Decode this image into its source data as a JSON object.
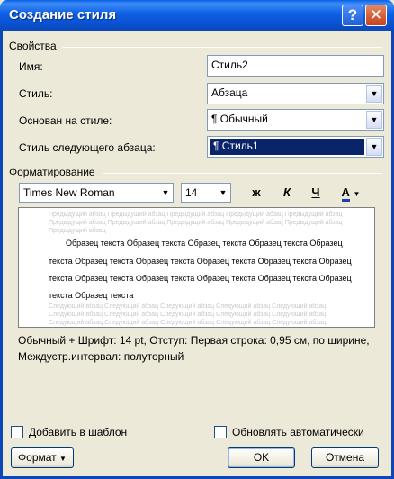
{
  "window": {
    "title": "Создание стиля"
  },
  "properties": {
    "group_label": "Свойства",
    "name_label": "Имя:",
    "name_value": "Стиль2",
    "style_label": "Стиль:",
    "style_value": "Абзаца",
    "based_on_label": "Основан на стиле:",
    "based_on_value": "¶ Обычный",
    "next_label": "Стиль следующего абзаца:",
    "next_value": "¶ Стиль1"
  },
  "formatting": {
    "group_label": "Форматирование",
    "font_name": "Times New Roman",
    "font_size": "14",
    "bold": "ж",
    "italic": "К",
    "underline": "Ч",
    "font_color": "А"
  },
  "preview": {
    "ghost_prev": "Предыдущий абзац Предыдущий абзац Предыдущий абзац Предыдущий абзац Предыдущий абзац",
    "ghost_prev2": "Предыдущий абзац Предыдущий абзац Предыдущий абзац Предыдущий абзац Предыдущий абзац",
    "ghost_prev3": "Предыдущий абзац",
    "line1": "Образец текста Образец текста Образец текста Образец текста Образец",
    "line2": "текста Образец текста Образец текста Образец текста Образец текста Образец",
    "line3": "текста Образец текста Образец текста Образец текста Образец текста Образец",
    "line4": "текста Образец текста",
    "ghost_next": "Следующий абзац Следующий абзац Следующий абзац Следующий абзац Следующий абзац"
  },
  "description": "Обычный + Шрифт: 14 pt, Отступ: Первая строка:  0,95 см, по ширине, Междустр.интервал:  полуторный",
  "options": {
    "add_template": "Добавить в шаблон",
    "auto_update": "Обновлять автоматически"
  },
  "buttons": {
    "format": "Формат",
    "ok": "OK",
    "cancel": "Отмена"
  },
  "colors": {
    "titlebar": "#0a53d4",
    "dialog_bg": "#ece9d8",
    "selection": "#0a246a"
  }
}
